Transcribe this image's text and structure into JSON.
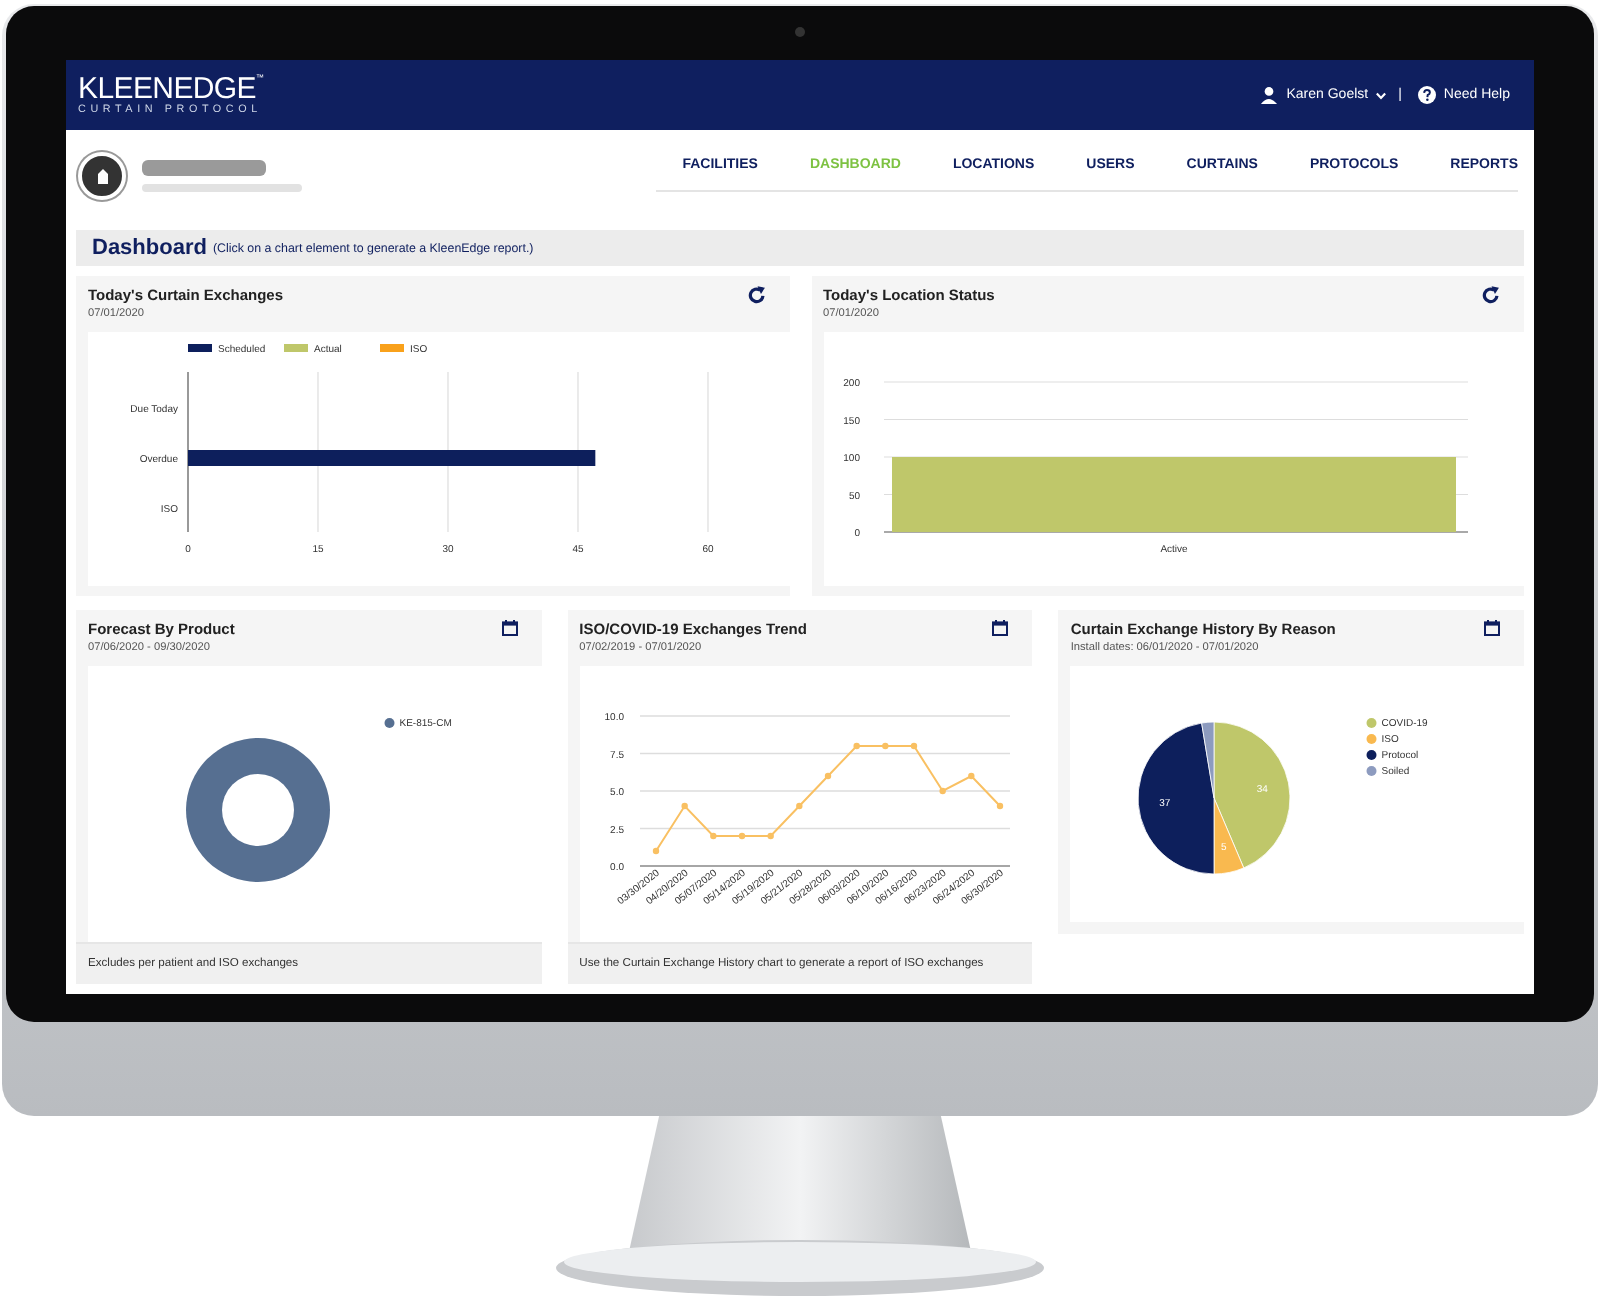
{
  "header": {
    "logo": {
      "name": "KLEENEDGE",
      "mark": "™",
      "tagline": "CURTAIN PROTOCOL"
    },
    "user": "Karen Goelst",
    "separator": "|",
    "help": "Need Help"
  },
  "nav": [
    {
      "label": "FACILITIES",
      "selected": false
    },
    {
      "label": "DASHBOARD",
      "selected": true
    },
    {
      "label": "LOCATIONS",
      "selected": false
    },
    {
      "label": "USERS",
      "selected": false
    },
    {
      "label": "CURTAINS",
      "selected": false
    },
    {
      "label": "PROTOCOLS",
      "selected": false
    },
    {
      "label": "REPORTS",
      "selected": false
    }
  ],
  "dashboard": {
    "title": "Dashboard",
    "hint": "(Click on a chart element to generate a KleenEdge report.)"
  },
  "cards": [
    {
      "title": "Today's Curtain Exchanges",
      "date": "07/01/2020",
      "kind": "refresh",
      "chart_data": {
        "type": "bar",
        "orientation": "horizontal",
        "categories": [
          "Due Today",
          "Overdue",
          "ISO"
        ],
        "series": [
          {
            "name": "Scheduled",
            "color": "#0d1f5c",
            "values": [
              0,
              47,
              0
            ]
          },
          {
            "name": "Actual",
            "color": "#bfc76a",
            "values": [
              0,
              0,
              0
            ]
          },
          {
            "name": "ISO",
            "color": "#f9a11b",
            "values": [
              0,
              0,
              0
            ]
          }
        ],
        "xlim": [
          0,
          60
        ],
        "xticks": [
          0,
          15,
          30,
          45,
          60
        ],
        "grid": true,
        "legend": "top"
      }
    },
    {
      "title": "Today's Location Status",
      "date": "07/01/2020",
      "kind": "refresh",
      "chart_data": {
        "type": "bar",
        "orientation": "vertical",
        "categories": [
          "Active"
        ],
        "series": [
          {
            "color": "#bfc76a",
            "values": [
              100
            ]
          }
        ],
        "ylim": [
          0,
          200
        ],
        "yticks": [
          0,
          50,
          100,
          150,
          200
        ],
        "grid": true
      }
    },
    {
      "title": "Forecast By Product",
      "date": "07/06/2020 - 09/30/2020",
      "kind": "calendar",
      "footer": "Excludes per patient and ISO exchanges",
      "chart_data": {
        "type": "donut",
        "categories": [
          "KE-815-CM"
        ],
        "series": [
          {
            "color": "#566f91",
            "values": [
              1
            ]
          }
        ],
        "legend": "right"
      }
    },
    {
      "title": "ISO/COVID-19 Exchanges Trend",
      "date": "07/02/2019 - 07/01/2020",
      "kind": "calendar",
      "footer": "Use the Curtain Exchange History chart to generate a report of ISO exchanges",
      "chart_data": {
        "type": "line",
        "categories": [
          "03/30/2020",
          "04/20/2020",
          "05/07/2020",
          "05/14/2020",
          "05/19/2020",
          "05/21/2020",
          "05/28/2020",
          "06/03/2020",
          "06/10/2020",
          "06/16/2020",
          "06/23/2020",
          "06/24/2020",
          "06/30/2020"
        ],
        "series": [
          {
            "color": "#f9c062",
            "marker": "circle",
            "values": [
              1,
              4,
              2,
              2,
              2,
              4,
              6,
              8,
              8,
              8,
              5,
              6,
              4
            ]
          }
        ],
        "ylim": [
          0,
          10
        ],
        "yticks": [
          {
            "value": 0,
            "label": "0.0"
          },
          {
            "value": 2.5,
            "label": "2.5"
          },
          {
            "value": 5,
            "label": "5.0"
          },
          {
            "value": 7.5,
            "label": "7.5"
          },
          {
            "value": 10,
            "label": "10.0"
          }
        ],
        "grid": true
      }
    },
    {
      "title": "Curtain Exchange History By Reason",
      "date": "Install dates: 06/01/2020 - 07/01/2020",
      "kind": "calendar",
      "chart_data": {
        "type": "pie",
        "categories": [
          "COVID-19",
          "ISO",
          "Protocol",
          "Soiled"
        ],
        "series": [
          {
            "values": [
              43.6,
              6.4,
              47.4,
              2.6
            ]
          }
        ],
        "colors": [
          "#bfc76a",
          "#f9b94f",
          "#0d1f5c",
          "#8d9bbf"
        ],
        "value_labels": [
          "34",
          "5",
          "37",
          null
        ],
        "legend": "right"
      }
    }
  ]
}
